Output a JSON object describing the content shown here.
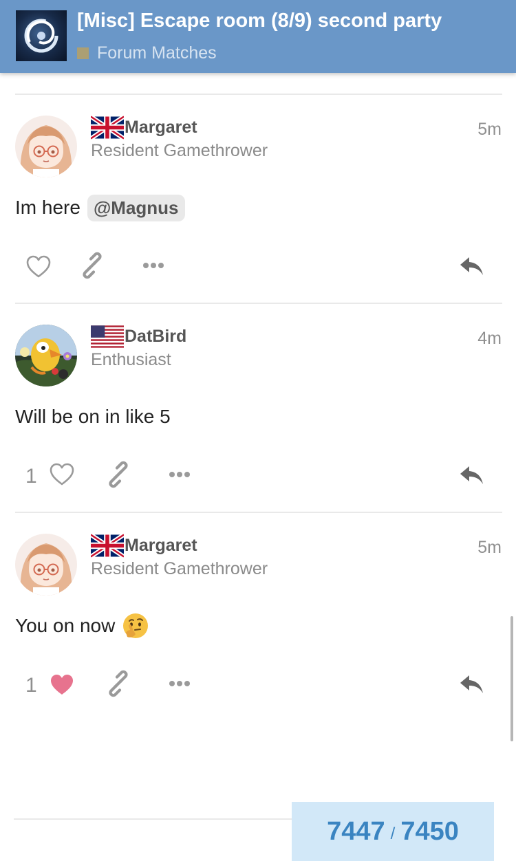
{
  "header": {
    "title": "[Misc] Escape room (8/9) second party",
    "category": "Forum Matches",
    "category_color": "#ab9f74",
    "background": "#6a97c8"
  },
  "posts": [
    {
      "username": "Margaret",
      "user_title": "Resident Gamethrower",
      "time": "5m",
      "flag": "uk-flag-icon",
      "text": "Im here",
      "mention": "@Magnus",
      "like_count": "",
      "liked": false
    },
    {
      "username": "DatBird",
      "user_title": "Enthusiast",
      "time": "4m",
      "flag": "us-flag-icon",
      "text": "Will be on in like 5",
      "like_count": "1",
      "liked": false
    },
    {
      "username": "Margaret",
      "user_title": "Resident Gamethrower",
      "time": "5m",
      "flag": "uk-flag-icon",
      "text": "You on now",
      "emoji": "thinking-face-icon",
      "like_count": "1",
      "liked": true
    }
  ],
  "progress": {
    "current": "7447",
    "separator": "/",
    "total": "7450"
  },
  "colors": {
    "liked_heart": "#e7738e",
    "progress_bg": "#d2e8f8",
    "progress_text": "#3a84c1"
  }
}
